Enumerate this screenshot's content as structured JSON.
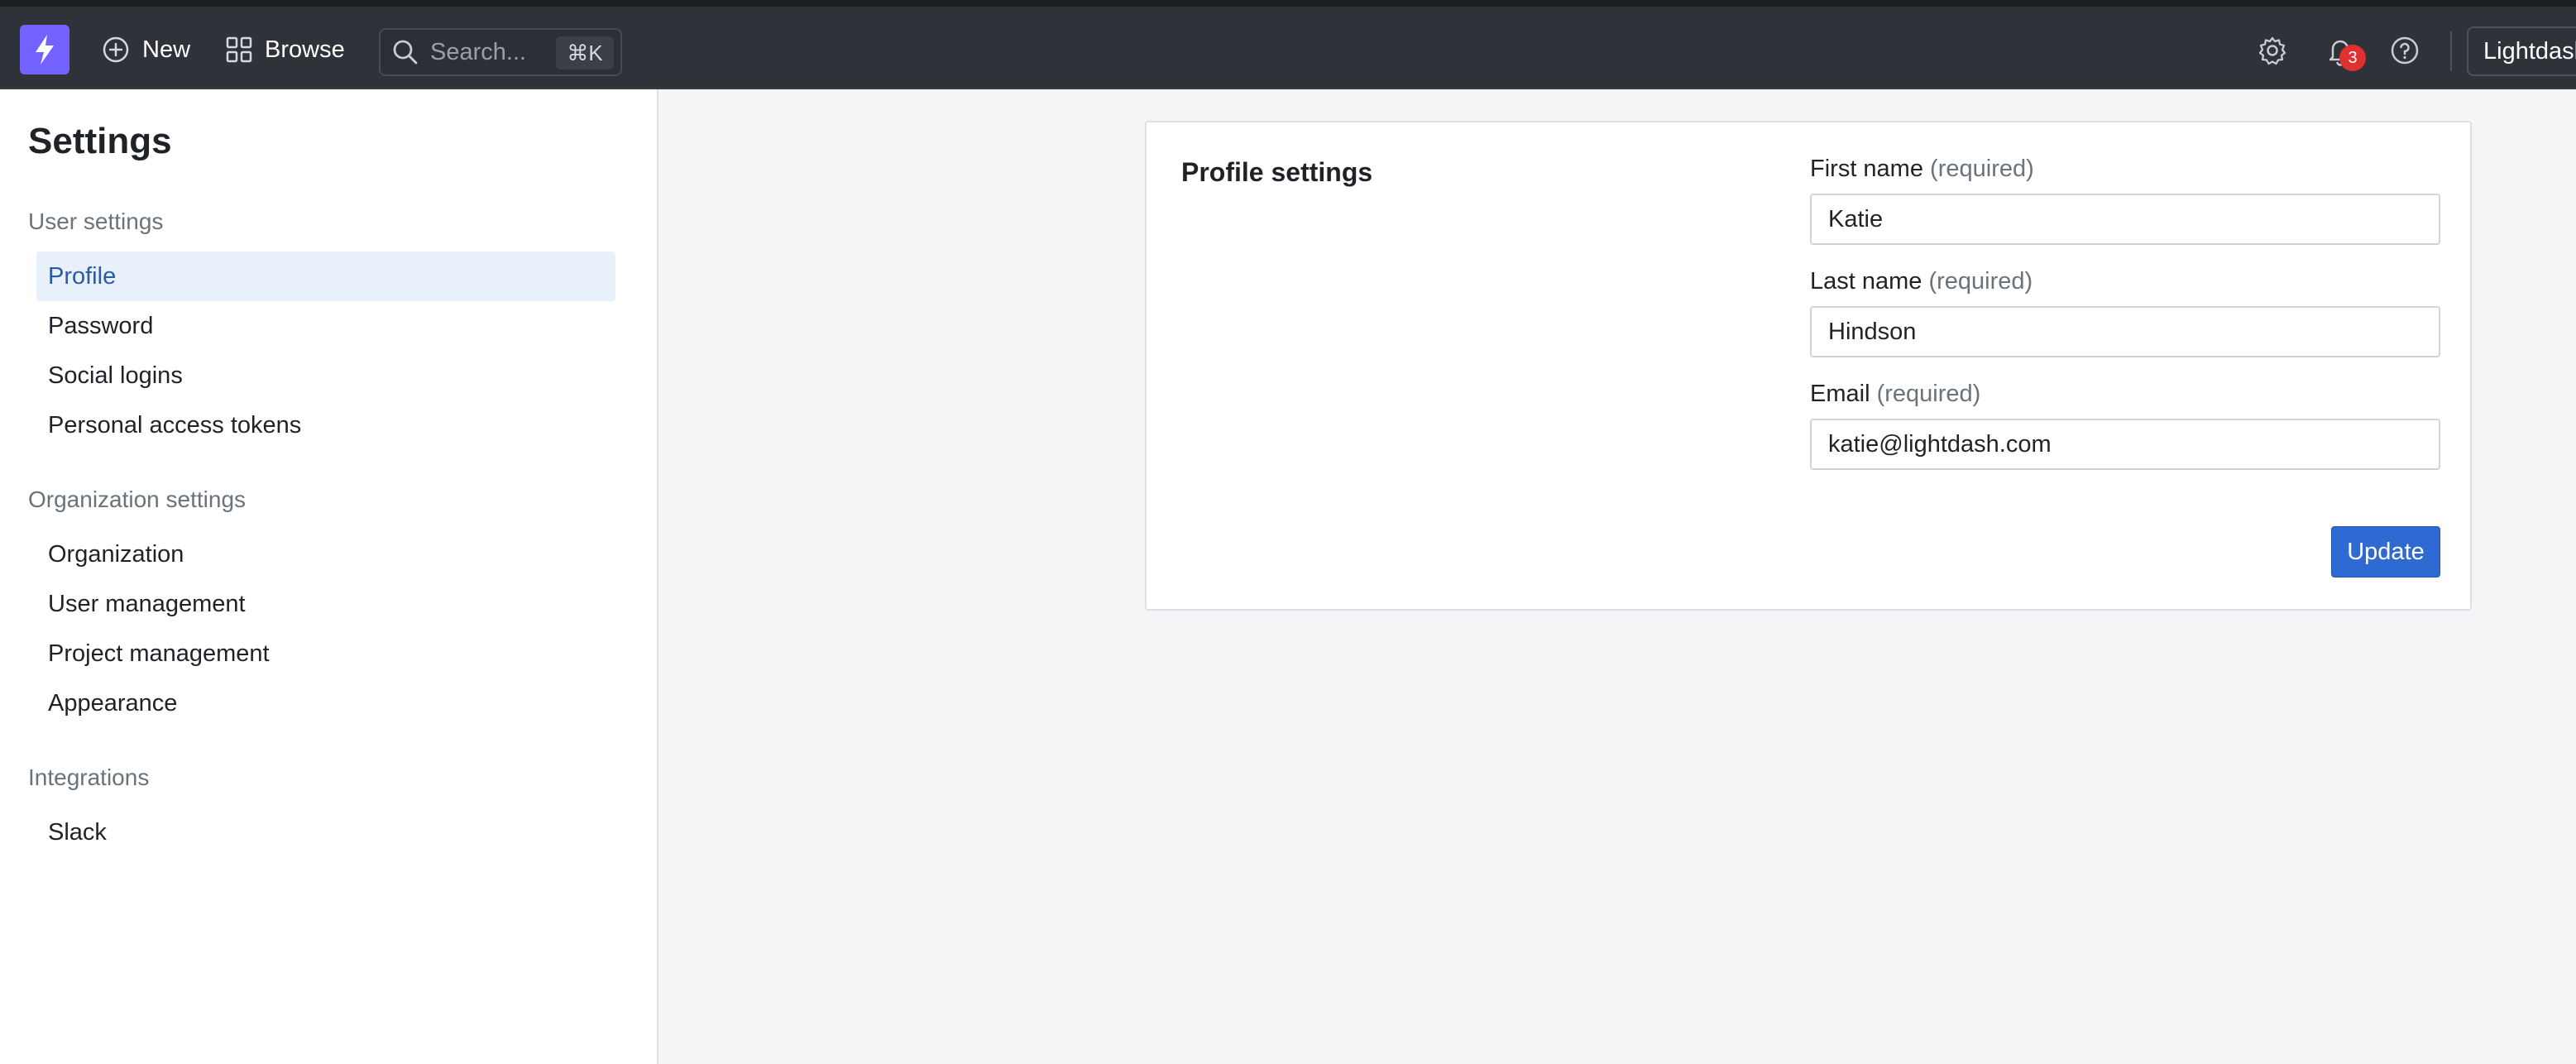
{
  "topbar": {
    "new_label": "New",
    "browse_label": "Browse",
    "search_placeholder": "Search...",
    "search_shortcut": "⌘K",
    "notifications_count": "3",
    "project_name": "Lightdash",
    "logo_color": "#7262ff"
  },
  "sidebar": {
    "title": "Settings",
    "sections": [
      {
        "label": "User settings",
        "items": [
          "Profile",
          "Password",
          "Social logins",
          "Personal access tokens"
        ]
      },
      {
        "label": "Organization settings",
        "items": [
          "Organization",
          "User management",
          "Project management",
          "Appearance"
        ]
      },
      {
        "label": "Integrations",
        "items": [
          "Slack"
        ]
      }
    ],
    "active_item": "Profile"
  },
  "profile": {
    "title": "Profile settings",
    "required_text": "(required)",
    "first_name": {
      "label": "First name",
      "value": "Katie"
    },
    "last_name": {
      "label": "Last name",
      "value": "Hindson"
    },
    "email": {
      "label": "Email",
      "value": "katie@lightdash.com"
    },
    "update_label": "Update",
    "accent_color": "#2e6ad1"
  }
}
